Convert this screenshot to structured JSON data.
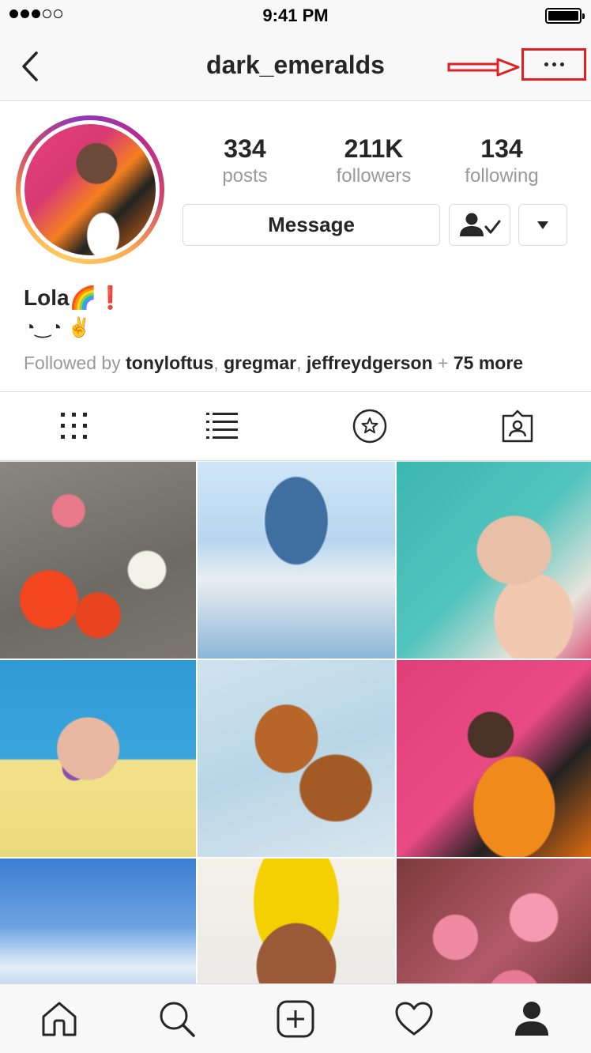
{
  "status_bar": {
    "time": "9:41 PM",
    "signal_bars": 3,
    "signal_total": 5
  },
  "nav": {
    "title": "dark_emeralds",
    "back_icon": "chevron-left-icon",
    "more_icon": "more-horizontal-icon",
    "annotation_color": "#e02020"
  },
  "profile": {
    "stats": [
      {
        "value": "334",
        "label": "posts"
      },
      {
        "value": "211K",
        "label": "followers"
      },
      {
        "value": "134",
        "label": "following"
      }
    ],
    "message_label": "Message",
    "follow_icon": "user-following-icon",
    "dropdown_icon": "triangle-down-icon",
    "name": "Lola🌈❗",
    "bio": "◔‿◔ ✌️",
    "followed_by": {
      "prefix": "Followed by ",
      "users": [
        "tonyloftus",
        "gregmar",
        "jeffreydgerson"
      ],
      "sep": ", ",
      "plus": " + ",
      "more": "75 more"
    }
  },
  "tabs": [
    "grid-icon",
    "list-icon",
    "star-circle-icon",
    "tagged-person-icon"
  ],
  "grid": {
    "rows": 3,
    "cols": 3
  },
  "bottom_nav": [
    "home-icon",
    "search-icon",
    "add-post-icon",
    "heart-icon",
    "profile-icon"
  ],
  "colors": {
    "accent_gradient": [
      "#fccc63",
      "#cd486b",
      "#8a3ab9"
    ],
    "text": "#262626",
    "muted": "#999999",
    "border": "#dbdbdb"
  }
}
